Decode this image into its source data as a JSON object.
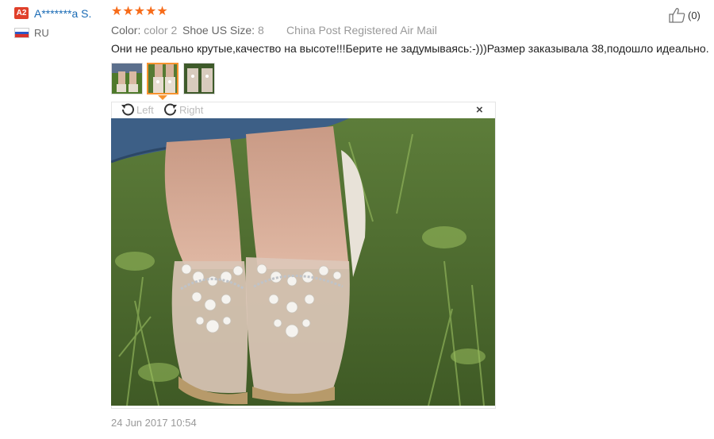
{
  "review": {
    "level_badge": "A2",
    "user_name": "A*******a S.",
    "country": "RU",
    "stars": "★★★★★",
    "rating": 5,
    "color_label": "Color:",
    "color_value": "color 2",
    "size_label": "Shoe US Size:",
    "size_value": "8",
    "shipping": "China Post Registered Air Mail",
    "text": "Они не реально крутые,качество на высоте!!!Берите не задумываясь:-)))Размер заказывала 38,подошло идеально.",
    "helpful_count": "(0)",
    "date": "24 Jun 2017 10:54"
  },
  "viewer": {
    "rotate_left_label": "Left",
    "rotate_right_label": "Right",
    "close_label": "×",
    "thumbnails": [
      {
        "name": "thumbnail-1",
        "active": false
      },
      {
        "name": "thumbnail-2",
        "active": true
      },
      {
        "name": "thumbnail-3",
        "active": false
      }
    ]
  },
  "colors": {
    "accent": "#f7932f",
    "stars": "#f76c1a",
    "user_link": "#1a6bb5",
    "badge": "#e0402a"
  }
}
